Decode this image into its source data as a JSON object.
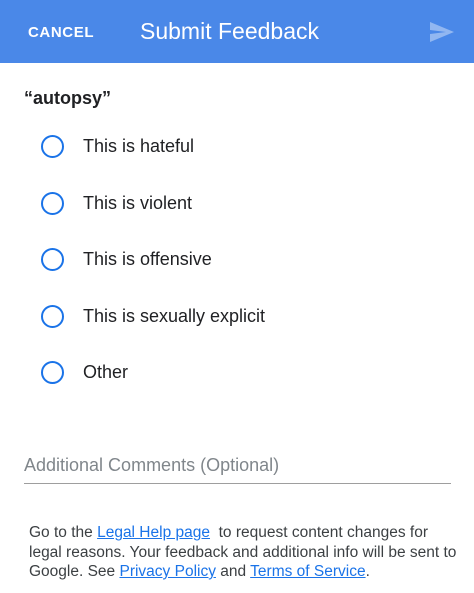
{
  "header": {
    "cancel_label": "CANCEL",
    "title": "Submit Feedback",
    "send_icon": "send-icon",
    "background_color": "#4a88e8"
  },
  "query": "“autopsy”",
  "options": [
    {
      "label": "This is hateful",
      "selected": false
    },
    {
      "label": "This is violent",
      "selected": false
    },
    {
      "label": "This is offensive",
      "selected": false
    },
    {
      "label": "This is sexually explicit",
      "selected": false
    },
    {
      "label": "Other",
      "selected": false
    }
  ],
  "comments": {
    "value": "",
    "placeholder": "Additional Comments (Optional)"
  },
  "footer": {
    "text_1": "Go to the ",
    "legal_help_link": "Legal Help page",
    "text_2": "  to request content changes for legal reasons. Your feedback and additional info will be sent to Google. See ",
    "privacy_link": "Privacy Policy",
    "text_3": " and ",
    "terms_link": "Terms of Service",
    "text_4": "."
  },
  "colors": {
    "accent": "#1a73e8",
    "radio_border": "#1a73e8"
  }
}
